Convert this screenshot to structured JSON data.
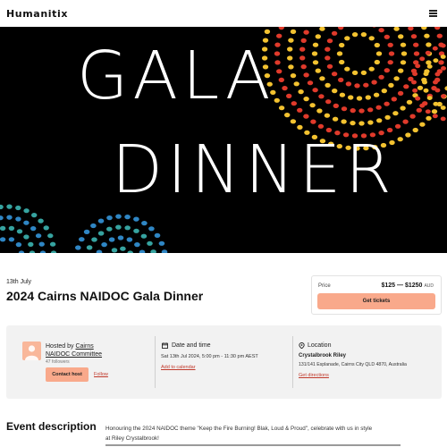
{
  "header": {
    "logo_text": "Humanitix",
    "menu_icon": "hamburger-menu-icon"
  },
  "banner": {
    "line1": "GALA",
    "line2": "DINNER",
    "colors": {
      "background": "#000000",
      "text": "#ffffff",
      "dots_red": "#e03a2b",
      "dots_yellow": "#f3c230",
      "dots_blue": "#2f86c4",
      "dots_teal": "#36a3a0"
    }
  },
  "event": {
    "date": "13th July",
    "title": "2024 Cairns NAIDOC Gala Dinner"
  },
  "price_box": {
    "label": "Price",
    "range": "$125 — $1250",
    "currency": "AUD",
    "button_label": "Get tickets"
  },
  "host": {
    "prefix": "Hosted by",
    "name_line1": "Cairns",
    "name_line2": "NAIDOC Committee",
    "followers": "47 followers",
    "contact_label": "Contact host",
    "follow_label": "Follow"
  },
  "datetime": {
    "icon": "calendar-icon",
    "title": "Date and time",
    "value": "Sat 13th Jul 2024, 5:00 pm - 11:30 pm AEST",
    "link": "Add to calendar"
  },
  "location": {
    "icon": "map-pin-icon",
    "title": "Location",
    "venue": "Crystalbrook Riley",
    "address": "131/141 Esplanade, Cairns City QLD 4870, Australia",
    "link": "Get directions"
  },
  "description": {
    "heading": "Event description",
    "text": "Honouring the 2024 NAIDOC theme \"Keep the Fire Burning! Blak, Loud & Proud\", celebrate with us in style at Riley Crystalbrook!"
  },
  "accent_color": "#f9a98b",
  "link_color": "#c0392b"
}
